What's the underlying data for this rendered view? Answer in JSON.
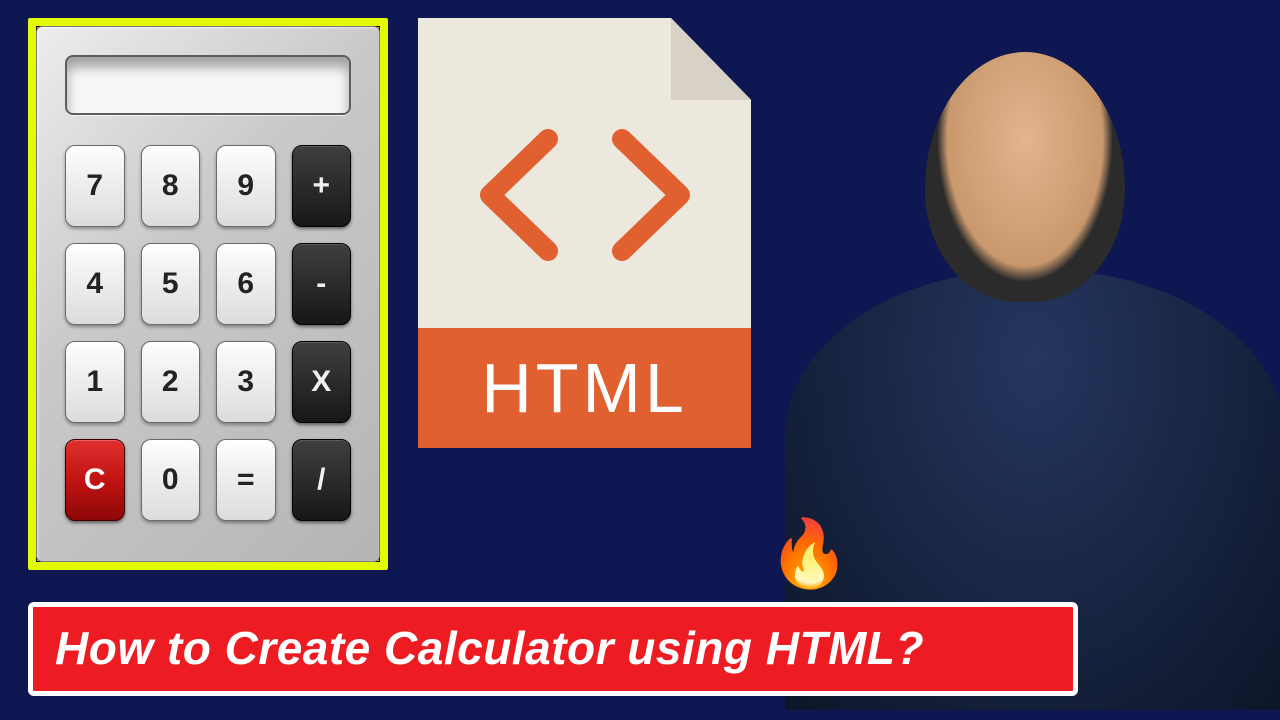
{
  "calculator": {
    "display_value": "",
    "keys": [
      {
        "label": "7",
        "style": "light"
      },
      {
        "label": "8",
        "style": "light"
      },
      {
        "label": "9",
        "style": "light"
      },
      {
        "label": "+",
        "style": "dark"
      },
      {
        "label": "4",
        "style": "light"
      },
      {
        "label": "5",
        "style": "light"
      },
      {
        "label": "6",
        "style": "light"
      },
      {
        "label": "-",
        "style": "dark"
      },
      {
        "label": "1",
        "style": "light"
      },
      {
        "label": "2",
        "style": "light"
      },
      {
        "label": "3",
        "style": "light"
      },
      {
        "label": "X",
        "style": "dark"
      },
      {
        "label": "C",
        "style": "red"
      },
      {
        "label": "0",
        "style": "light"
      },
      {
        "label": "=",
        "style": "light"
      },
      {
        "label": "/",
        "style": "dark"
      }
    ]
  },
  "file_icon": {
    "label": "HTML",
    "accent_color": "#e06030"
  },
  "emoji": {
    "fire": "🔥"
  },
  "banner": {
    "text": "How to Create Calculator using HTML?"
  }
}
